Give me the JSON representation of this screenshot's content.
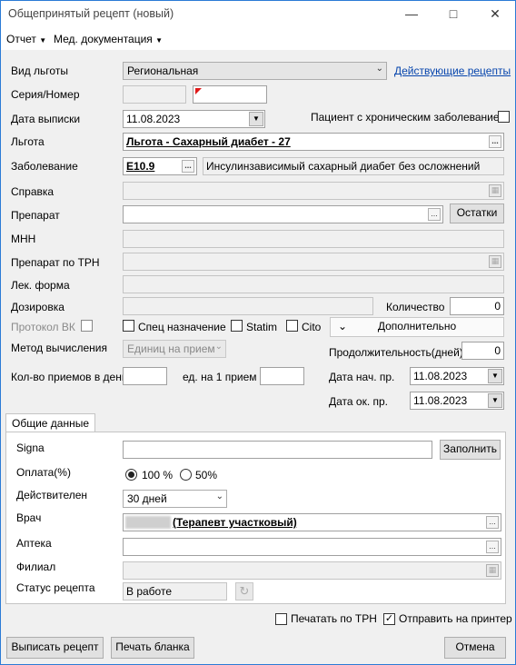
{
  "window": {
    "title": "Общепринятый рецепт (новый)"
  },
  "menu": [
    "Отчет",
    "Мед. документация"
  ],
  "form": {
    "benefit_type_label": "Вид льготы",
    "benefit_type_value": "Региональная",
    "active_recipes_link": "Действующие рецепты",
    "series_label": "Серия/Номер",
    "issue_date_label": "Дата выписки",
    "issue_date_value": "11.08.2023",
    "chronic_label": "Пациент с хроническим заболеванием",
    "benefit_label": "Льгота",
    "benefit_value": "Льгота - Сахарный диабет - 27",
    "disease_label": "Заболевание",
    "disease_code": "E10.9",
    "disease_name": "Инсулинзависимый сахарный диабет без осложнений",
    "certificate_label": "Справка",
    "drug_label": "Препарат",
    "stock_button": "Остатки",
    "inn_label": "МНН",
    "trn_drug_label": "Препарат по ТРН",
    "form_label": "Лек. форма",
    "dosage_label": "Дозировка",
    "quantity_label": "Количество",
    "quantity_value": "0",
    "vk_label": "Протокол ВК",
    "special_label": "Спец назначение",
    "statim_label": "Statim",
    "cito_label": "Cito",
    "more_button": "Дополнительно",
    "calc_method_label": "Метод вычисления",
    "calc_method_value": "Единиц на прием",
    "duration_label": "Продолжительность(дней)",
    "duration_value": "0",
    "doses_per_day_label": "Кол-во приемов в день",
    "units_per_dose_label": "ед. на 1 прием",
    "start_date_label": "Дата нач. пр.",
    "start_date_value": "11.08.2023",
    "end_date_label": "Дата ок. пр.",
    "end_date_value": "11.08.2023"
  },
  "tabs": {
    "general": "Общие данные"
  },
  "general": {
    "signa_label": "Signa",
    "fill_button": "Заполнить",
    "payment_label": "Оплата(%)",
    "payment_100": "100 %",
    "payment_50": "50%",
    "valid_label": "Действителен",
    "valid_value": "30 дней",
    "doctor_label": "Врач",
    "doctor_value": "(Терапевт участковый)",
    "pharmacy_label": "Аптека",
    "branch_label": "Филиал",
    "status_label": "Статус рецепта",
    "status_value": "В работе"
  },
  "footer": {
    "print_trn": "Печатать по ТРН",
    "send_printer": "Отправить на принтер",
    "issue_button": "Выписать рецепт",
    "print_form_button": "Печать бланка",
    "cancel_button": "Отмена"
  }
}
